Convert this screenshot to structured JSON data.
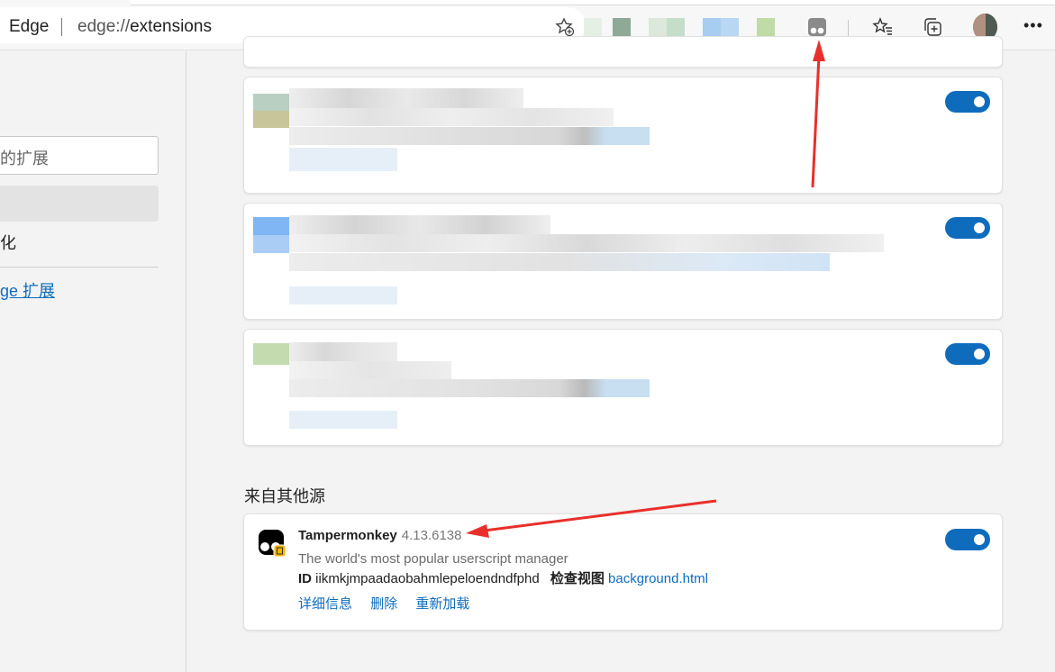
{
  "browser": {
    "brand": "Edge",
    "url_prefix": "edge://",
    "url_path": "extensions"
  },
  "sidebar": {
    "search_placeholder": "的扩展",
    "item_label": "化",
    "link_label": "ge 扩展"
  },
  "sections": {
    "other_sources_title": "来自其他源"
  },
  "extension": {
    "name": "Tampermonkey",
    "version": "4.13.6138",
    "description": "The world's most popular userscript manager",
    "id_label": "ID",
    "id_value": "iikmkjmpaadaobahmlepeloendndfphd",
    "inspect_label": "检查视图",
    "inspect_link": "background.html",
    "actions": [
      "详细信息",
      "删除",
      "重新加载"
    ],
    "enabled": true
  },
  "colors": {
    "accent": "#0f6cbd",
    "arrow": "#e8302a"
  }
}
